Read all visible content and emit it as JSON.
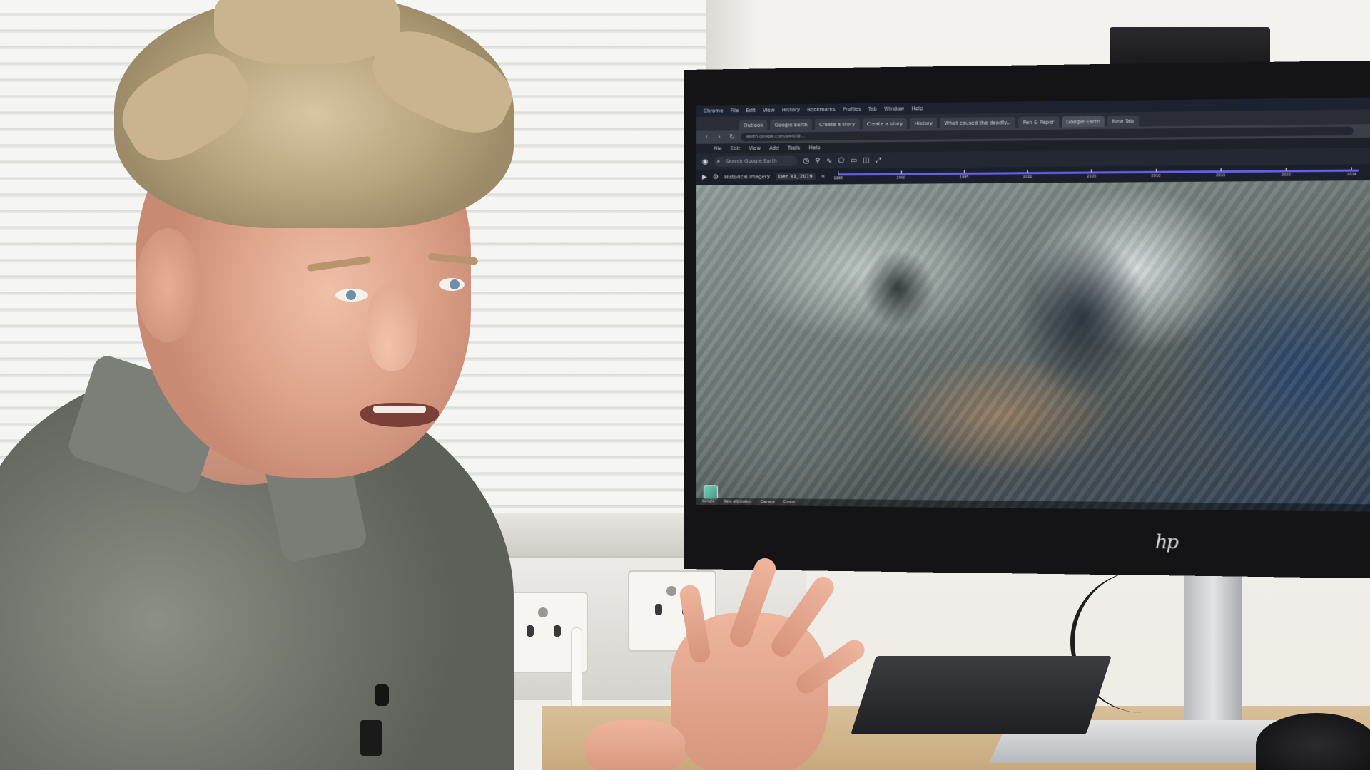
{
  "monitor": {
    "brand": "hp",
    "browser": {
      "os_menu": [
        "Chrome",
        "File",
        "Edit",
        "View",
        "History",
        "Bookmarks",
        "Profiles",
        "Tab",
        "Window",
        "Help"
      ],
      "tabs": [
        {
          "label": "Outlook",
          "active": false
        },
        {
          "label": "Google Earth",
          "active": false
        },
        {
          "label": "Create a story",
          "active": false
        },
        {
          "label": "Create a story",
          "active": false
        },
        {
          "label": "History",
          "active": false
        },
        {
          "label": "What caused the deadly...",
          "active": false
        },
        {
          "label": "Pen & Paper",
          "active": false
        },
        {
          "label": "Google Earth",
          "active": true
        },
        {
          "label": "New Tab",
          "active": false
        }
      ],
      "url": "earth.google.com/web/@...",
      "app_menu": [
        "File",
        "Edit",
        "View",
        "Add",
        "Tools",
        "Help"
      ],
      "search_placeholder": "Search Google Earth",
      "imagery_label": "Historical imagery",
      "date": "Dec 31, 2019",
      "timeline_years": [
        "1984",
        "1990",
        "1995",
        "2000",
        "2005",
        "2010",
        "2015",
        "2020",
        "2024"
      ],
      "status_items": [
        "Google",
        "Data attribution",
        "Camera",
        "Cursor"
      ]
    }
  },
  "scene_icons": {
    "search": "search-icon",
    "layers": "layers-icon"
  }
}
